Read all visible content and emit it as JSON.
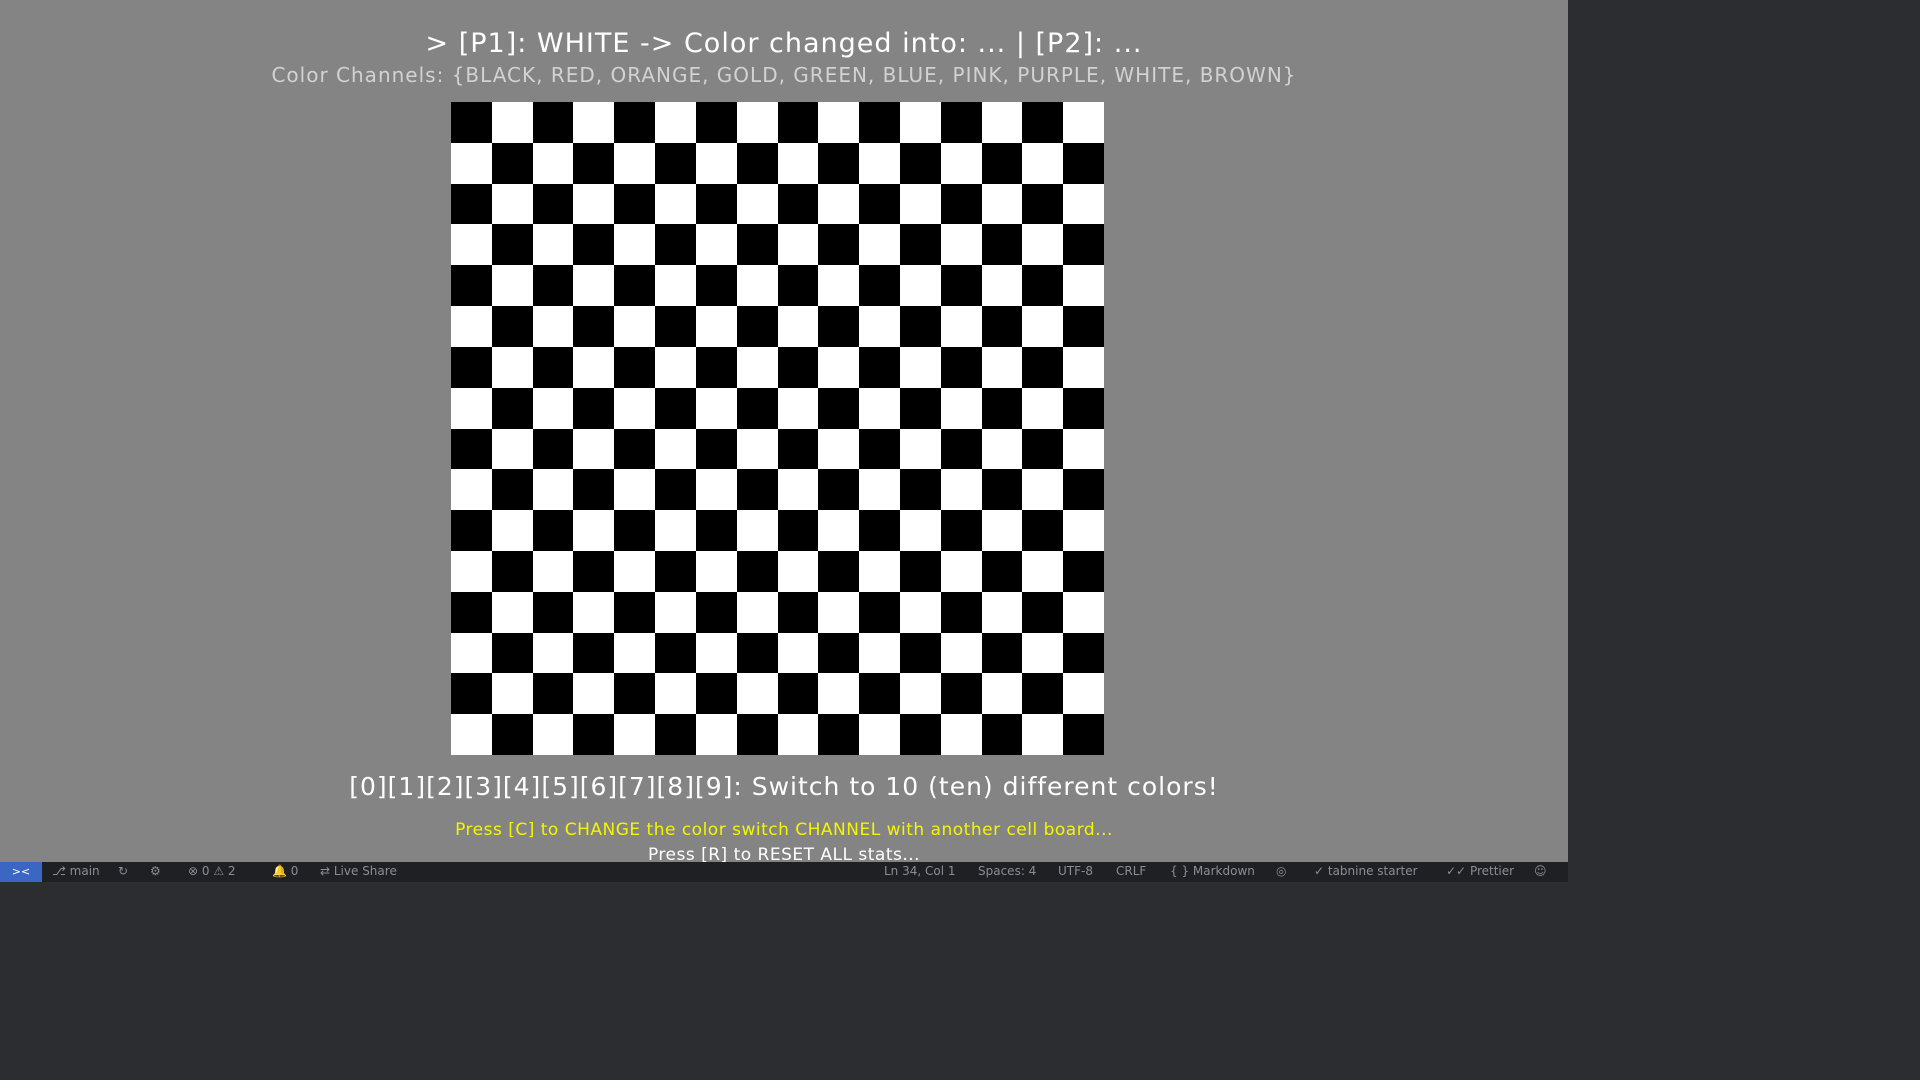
{
  "game": {
    "player_status": "> [P1]: WHITE -> Color changed into: ... | [P2]: ...",
    "channels_line": "Color Channels: {BLACK, RED, ORANGE, GOLD, GREEN, BLUE, PINK, PURPLE, WHITE, BROWN}",
    "switch_hint": "[0][1][2][3][4][5][6][7][8][9]: Switch to 10 (ten) different colors!",
    "change_hint": "Press [C] to CHANGE the color switch CHANNEL with another cell board...",
    "reset_hint": "Press [R] to RESET ALL stats..."
  },
  "board": {
    "rows": 16,
    "cols": 16,
    "dark_color": "#000000",
    "light_color": "#ffffff",
    "top_left": "dark"
  },
  "colors": {
    "background": "#848484",
    "status_text": "#ffffff",
    "channels_text": "#d2d2d2",
    "change_hint_text": "#f5f500",
    "statusbar_bg": "#1f2023",
    "remote_bg": "#3b66c4"
  },
  "statusbar": {
    "remote_icon": "remote-icon",
    "branch": "main",
    "errors": "0",
    "warnings": "2",
    "notifications": "0",
    "live_share": "Live Share",
    "position": "Ln 34, Col 1",
    "spaces": "Spaces: 4",
    "encoding": "UTF-8",
    "eol": "CRLF",
    "language": "Markdown",
    "tabnine": "tabnine starter",
    "prettier": "Prettier"
  }
}
